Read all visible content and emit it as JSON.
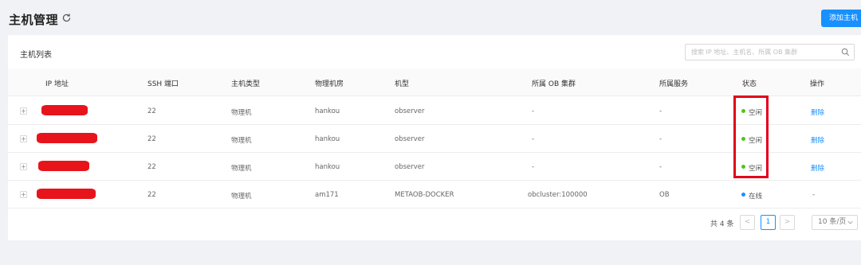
{
  "header": {
    "title": "主机管理",
    "refresh_icon": "refresh-icon",
    "add_button": "添加主机"
  },
  "card": {
    "title": "主机列表",
    "search_placeholder": "搜索 IP 地址、主机名、所属 OB 集群",
    "search_icon": "search-icon"
  },
  "table": {
    "columns": [
      "IP 地址",
      "SSH 端口",
      "主机类型",
      "物理机房",
      "机型",
      "所属 OB 集群",
      "所属服务",
      "状态",
      "操作"
    ],
    "rows": [
      {
        "ip": "",
        "ssh_port": "22",
        "host_type": "物理机",
        "idc": "hankou",
        "model": "observer",
        "ob_cluster": "-",
        "service": "-",
        "status": "空闲",
        "status_color": "#52c41a",
        "action": "删除"
      },
      {
        "ip": "",
        "ssh_port": "22",
        "host_type": "物理机",
        "idc": "hankou",
        "model": "observer",
        "ob_cluster": "-",
        "service": "-",
        "status": "空闲",
        "status_color": "#52c41a",
        "action": "删除"
      },
      {
        "ip": "",
        "ssh_port": "22",
        "host_type": "物理机",
        "idc": "hankou",
        "model": "observer",
        "ob_cluster": "-",
        "service": "-",
        "status": "空闲",
        "status_color": "#52c41a",
        "action": "删除"
      },
      {
        "ip": "",
        "ssh_port": "22",
        "host_type": "物理机",
        "idc": "am171",
        "model": "METAOB-DOCKER",
        "ob_cluster": "obcluster:100000",
        "service": "OB",
        "status": "在线",
        "status_color": "#1890ff",
        "action": "-"
      }
    ]
  },
  "pagination": {
    "total": "共 4 条",
    "prev": "<",
    "current": "1",
    "next": ">",
    "page_size": "10 条/页"
  },
  "colors": {
    "accent": "#1890ff",
    "idle": "#52c41a",
    "online": "#1890ff",
    "highlight": "#e0001b"
  }
}
